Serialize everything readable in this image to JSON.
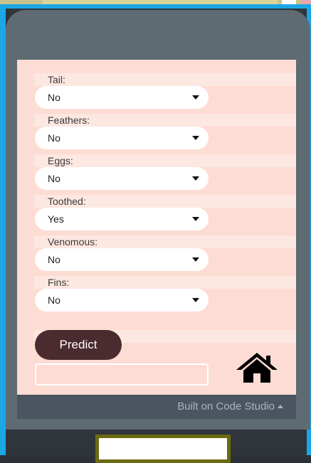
{
  "form": {
    "fields": [
      {
        "label": "Tail:",
        "value": "No"
      },
      {
        "label": "Feathers:",
        "value": "No"
      },
      {
        "label": "Eggs:",
        "value": "No"
      },
      {
        "label": "Toothed:",
        "value": "Yes"
      },
      {
        "label": "Venomous:",
        "value": "No"
      },
      {
        "label": "Fins:",
        "value": "No"
      }
    ],
    "predict_label": "Predict",
    "result_value": ""
  },
  "footer": {
    "text": "Built on Code Studio"
  },
  "icons": {
    "home": "home-icon",
    "dropdown": "caret-down-icon",
    "footer_toggle": "caret-up-icon"
  },
  "colors": {
    "frame": "#1aa7e6",
    "screen": "#fddcd3",
    "button": "#4a2b2f",
    "device": "#5f6b73"
  }
}
